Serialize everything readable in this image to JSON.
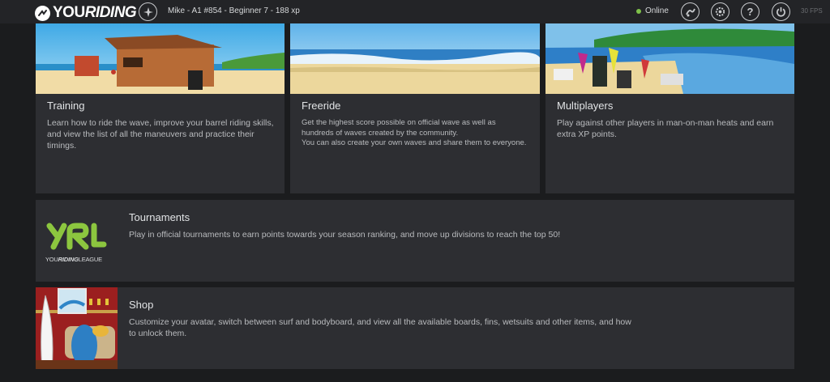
{
  "topbar": {
    "brand_part1": "YOU",
    "brand_part2": "RIDING",
    "profile": "Mike - A1 #854 - Beginner 7 - 188 xp",
    "status": "Online",
    "status_color": "#7fc24a",
    "fps": "30 FPS",
    "icons": [
      "profile-icon",
      "skills-icon",
      "gear-icon",
      "help-icon",
      "power-icon"
    ]
  },
  "cards": {
    "training": {
      "title": "Training",
      "desc": "Learn how to ride the wave, improve your barrel riding skills, and view the list of all the maneuvers and practice their timings."
    },
    "freeride": {
      "title": "Freeride",
      "desc1": "Get the highest score possible on official wave as well as hundreds of waves created by the community.",
      "desc2": "You can also create your own waves and share them to everyone."
    },
    "multiplayers": {
      "title": "Multiplayers",
      "desc": "Play against other players in man-on-man heats and earn extra XP points."
    },
    "tournaments": {
      "title": "Tournaments",
      "desc": "Play in official tournaments to earn points towards your season ranking, and move up divisions to reach the top 50!",
      "logo_text_1": "YOU",
      "logo_text_2": "RIDING",
      "logo_text_3": "LEAGUE",
      "logo_color": "#8cc63f"
    },
    "shop": {
      "title": "Shop",
      "desc": "Customize your avatar, switch between surf and bodyboard, and view all the available boards, fins, wetsuits and other items, and how to unlock them."
    }
  }
}
